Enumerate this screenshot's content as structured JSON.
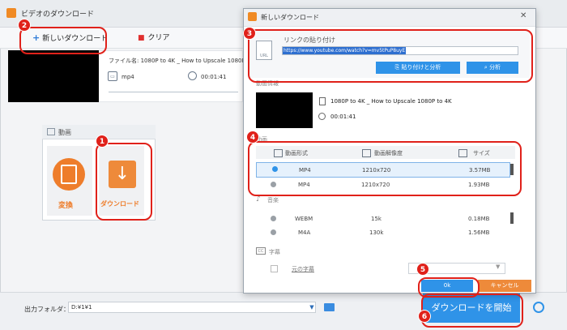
{
  "app": {
    "title": "ビデオのダウンロード"
  },
  "toolbar": {
    "new_download": "新しいダウンロード",
    "clear": "クリア"
  },
  "task": {
    "file_name": "ファイル名: 1080P to 4K _ How to Upscale 1080P to",
    "format": "mp4",
    "duration": "00:01:41"
  },
  "mode": {
    "header": "動画",
    "convert": "変換",
    "download": "ダウンロード"
  },
  "output": {
    "label": "出力フォルダ：",
    "path": "D:¥1¥1"
  },
  "start_button": "ダウンロードを開始",
  "dialog": {
    "title": "新しいダウンロード",
    "link_label": "リンクの貼り付け",
    "link_icon": "URL",
    "url": "https://www.youtube.com/watch?v=mv5tPuP8uyE",
    "paste_analyze": "貼り付けと分析",
    "analyze": "分析",
    "video_info_label": "動画情報",
    "video_title": "1080P to 4K _ How to Upscale 1080P to 4K",
    "video_duration": "00:01:41",
    "video_section": "動画",
    "headers": {
      "format": "動画形式",
      "resolution": "動画解像度",
      "size": "サイズ"
    },
    "video_rows": [
      {
        "format": "MP4",
        "resolution": "1210x720",
        "size": "3.57MB"
      },
      {
        "format": "MP4",
        "resolution": "1210x720",
        "size": "1.93MB"
      }
    ],
    "audio_section": "音楽",
    "audio_rows": [
      {
        "format": "WEBM",
        "bitrate": "15k",
        "size": "0.18MB"
      },
      {
        "format": "M4A",
        "bitrate": "130k",
        "size": "1.56MB"
      }
    ],
    "subtitle_section": "字幕",
    "subtitle_icon": "CC",
    "original_subtitle": "元の字幕",
    "ok": "0k",
    "cancel": "キャンセル"
  },
  "annotations": [
    "1",
    "2",
    "3",
    "4",
    "5",
    "6"
  ],
  "colors": {
    "accent_blue": "#2f93e8",
    "accent_orange": "#ee8a3a",
    "annotation_red": "#e0211a"
  }
}
